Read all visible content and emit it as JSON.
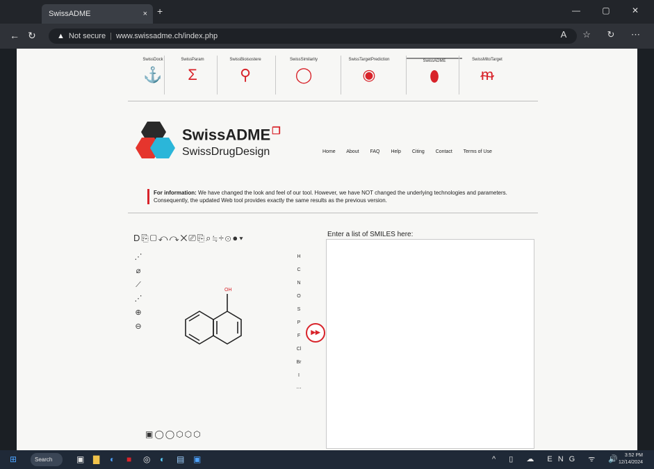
{
  "browser": {
    "tab_title": "SwissADME",
    "tab_close": "×",
    "new_tab": "+",
    "window_controls": "—  ▢  ✕",
    "address_security": "Not secure",
    "address_url": "www.swissadme.ch/index.php",
    "back": "←",
    "refresh": "↻",
    "right_icons": "A  ☆  ↻  ⋯"
  },
  "tools": [
    {
      "name": "SwissDock",
      "icon": "⚓"
    },
    {
      "name": "SwissParam",
      "icon": "Σ"
    },
    {
      "name": "SwissBioisostere",
      "icon": "⚲"
    },
    {
      "name": "SwissSimilarity",
      "icon": "◯"
    },
    {
      "name": "SwissTargetPrediction",
      "icon": "◉"
    },
    {
      "name": "SwissADME",
      "icon": "⬮"
    },
    {
      "name": "SwissMitoTarget",
      "icon": "ᵯ"
    }
  ],
  "brand": {
    "title": "SwissADME",
    "sup": "❐",
    "subtitle": "SwissDrugDesign"
  },
  "menu": [
    "Home",
    "About",
    "FAQ",
    "Help",
    "Citing",
    "Contact",
    "Terms of Use"
  ],
  "notice": {
    "label": "For information:",
    "text": "We have changed the look and feel of our tool. However, we have NOT changed the underlying technologies and parameters. Consequently, the updated Web tool provides exactly the same results as the previous version."
  },
  "editor": {
    "toolbar_glyphs": "D⎘▢↶↷✕⎚⎘⌕≒÷⊙●▾",
    "left_tools": [
      "⋰",
      "⌀",
      "⟋",
      "⋰",
      "⊕",
      "⊖"
    ],
    "atoms": [
      "H",
      "C",
      "N",
      "O",
      "S",
      "P",
      "F",
      "Cl",
      "Br",
      "I",
      "⋯"
    ],
    "shapes": "▣◯◯⬡⬡⬡",
    "oh_label": "OH"
  },
  "go_button": "▸▸",
  "smiles": {
    "label": "Enter a list of SMILES here:"
  },
  "taskbar": {
    "search": "Search",
    "tray": "^ ▯ ☁ ENG ᯤ 🔊",
    "time": "3:52 PM",
    "date": "12/14/2024"
  },
  "colors": {
    "accent": "#d8232a",
    "logo_dark": "#2a2a2a",
    "logo_red": "#e5352d",
    "logo_cyan": "#2bb6d9"
  }
}
